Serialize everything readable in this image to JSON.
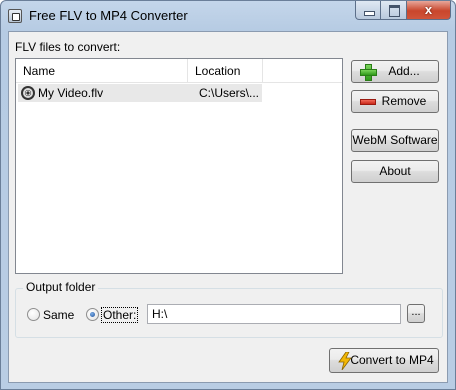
{
  "window": {
    "title": "Free FLV to MP4 Converter",
    "close_glyph": "x"
  },
  "files": {
    "label": "FLV files to convert:",
    "columns": [
      "Name",
      "Location"
    ],
    "rows": [
      {
        "name": "My Video.flv",
        "location": "C:\\Users\\...",
        "icon": "film-reel-icon"
      }
    ]
  },
  "buttons": {
    "add": "Add...",
    "remove": "Remove",
    "webm": "WebM Software",
    "about": "About",
    "convert": "Convert to MP4",
    "browse": "..."
  },
  "output": {
    "group_label": "Output folder",
    "radio_same": "Same",
    "radio_other": "Other:",
    "selected": "Other:",
    "path": "H:\\"
  },
  "colors": {
    "titlebar": "#b9cde4",
    "client_bg": "#f0f0f0",
    "close_button": "#c9462c",
    "add_icon": "#2f9a1a",
    "remove_icon": "#c8281a",
    "convert_icon": "#f2b705"
  }
}
